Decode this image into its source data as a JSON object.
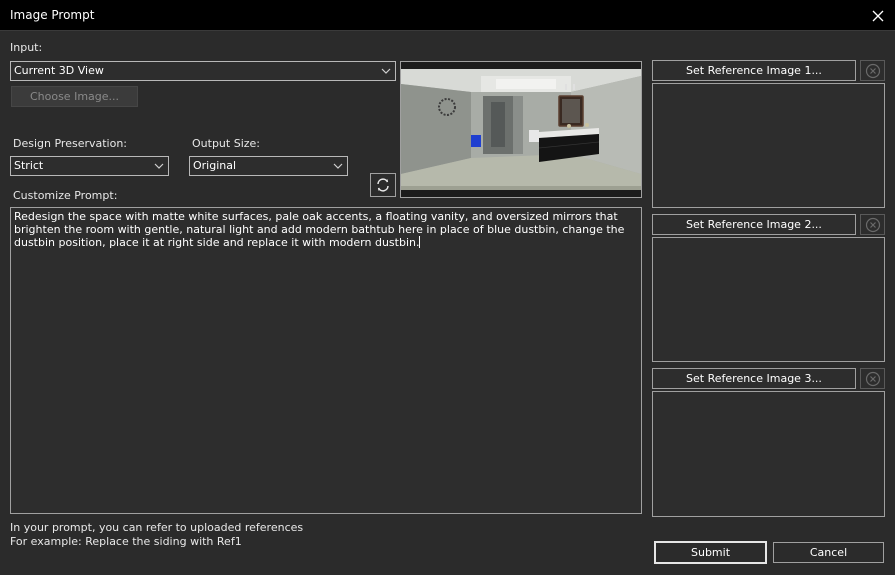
{
  "window": {
    "title": "Image Prompt",
    "close_icon": "close-icon"
  },
  "input": {
    "label": "Input:",
    "selected": "Current 3D View",
    "choose_image_label": "Choose Image..."
  },
  "design_preservation": {
    "label": "Design Preservation:",
    "selected": "Strict"
  },
  "output_size": {
    "label": "Output Size:",
    "selected": "Original"
  },
  "prompt": {
    "label": "Customize Prompt:",
    "text": "Redesign the space with matte white surfaces, pale oak accents, a floating vanity, and oversized mirrors that brighten the room with gentle, natural light and add modern bathtub here in place of blue dustbin, change the dustbin position, place it at right side and replace it with modern dustbin."
  },
  "references": [
    {
      "button_label": "Set Reference Image 1..."
    },
    {
      "button_label": "Set Reference Image 2..."
    },
    {
      "button_label": "Set Reference Image 3..."
    }
  ],
  "hints": {
    "line1": "In your prompt, you can refer to uploaded references",
    "line2": "For example: Replace the siding with Ref1"
  },
  "actions": {
    "submit_label": "Submit",
    "cancel_label": "Cancel"
  },
  "colors": {
    "background": "#2b2b2b",
    "titlebar": "#000000",
    "border": "#a0a0a0"
  }
}
